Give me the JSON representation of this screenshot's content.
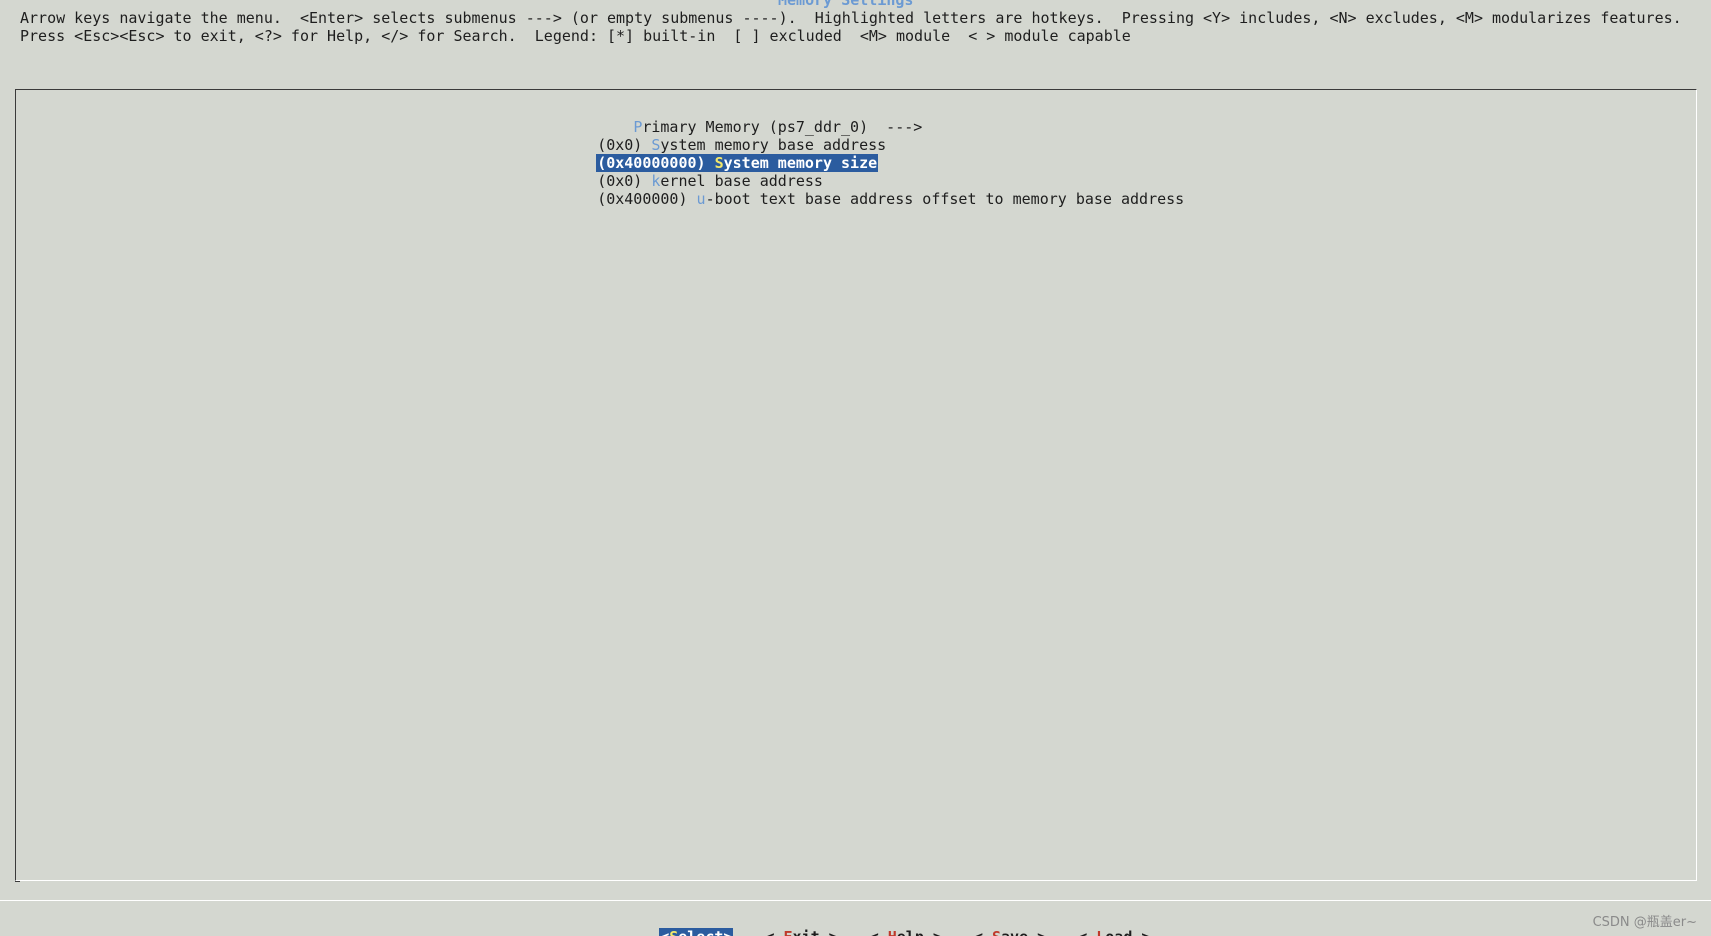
{
  "window": {
    "title": "Memory Settings"
  },
  "help": {
    "line1": "Arrow keys navigate the menu.  <Enter> selects submenus ---> (or empty submenus ----).  Highlighted letters are hotkeys.  Pressing <Y> includes, <N> excludes, <M> modularizes features.",
    "line2": "Press <Esc><Esc> to exit, <?> for Help, </> for Search.  Legend: [*] built-in  [ ] excluded  <M> module  < > module capable"
  },
  "menu": {
    "items": [
      {
        "prefix": "    ",
        "hotkey": "P",
        "rest": "rimary Memory (ps7_ddr_0)  --->",
        "selected": false
      },
      {
        "prefix": "(0x0) ",
        "hotkey": "S",
        "rest": "ystem memory base address",
        "selected": false
      },
      {
        "prefix": "(0x40000000) ",
        "hotkey": "S",
        "rest": "ystem memory size",
        "selected": true
      },
      {
        "prefix": "(0x0) ",
        "hotkey": "k",
        "rest": "ernel base address",
        "selected": false
      },
      {
        "prefix": "(0x400000) ",
        "hotkey": "u",
        "rest": "-boot text base address offset to memory base address",
        "selected": false
      }
    ]
  },
  "buttons": {
    "select": {
      "open": "<",
      "key": "S",
      "rest": "elect>",
      "close": ""
    },
    "exit": {
      "open": "< ",
      "key": "E",
      "rest": "xit",
      "close": " >"
    },
    "help": {
      "open": "< ",
      "key": "H",
      "rest": "elp",
      "close": " >"
    },
    "save": {
      "open": "< ",
      "key": "S",
      "rest": "ave",
      "close": " >"
    },
    "load": {
      "open": "< ",
      "key": "L",
      "rest": "oad",
      "close": " >"
    }
  },
  "watermark": "CSDN @瓶盖er~",
  "colors": {
    "background": "#d4d7d0",
    "selection": "#2b5c9f",
    "hotkey": "#6b9ad3",
    "selected_hotkey": "#f3e86b",
    "button_key": "#c0392b"
  }
}
